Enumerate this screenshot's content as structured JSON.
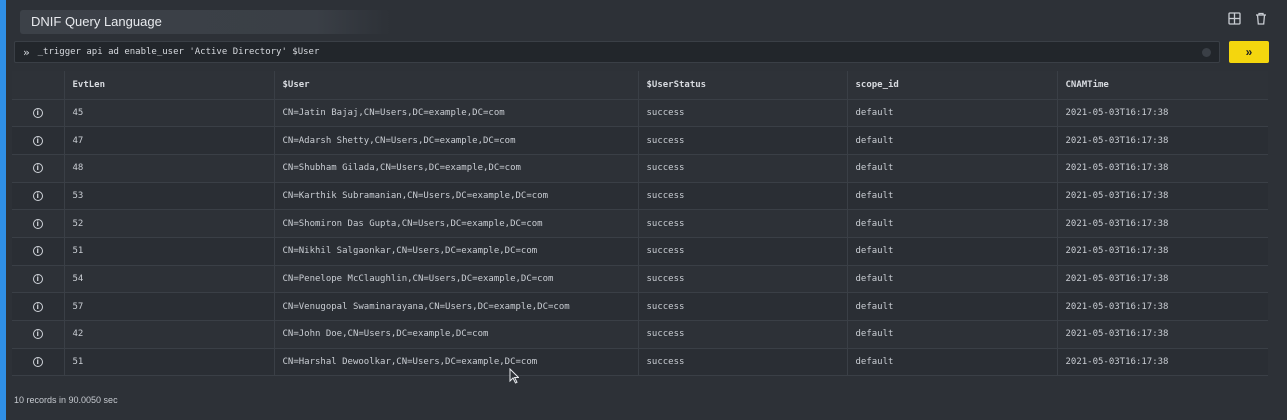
{
  "panel": {
    "title": "DNIF Query Language",
    "accent_color": "#2f8fe6",
    "icons": {
      "layout": "table-layout-icon",
      "delete": "trash-icon"
    }
  },
  "query": {
    "prompt_symbol": "»",
    "text": "_trigger api ad enable_user 'Active Directory' $User",
    "run_label": "»",
    "run_color": "#f4d60e"
  },
  "table": {
    "columns": [
      "",
      "EvtLen",
      "$User",
      "$UserStatus",
      "scope_id",
      "CNAMTime"
    ],
    "rows": [
      [
        "45",
        "CN=Jatin Bajaj,CN=Users,DC=example,DC=com",
        "success",
        "default",
        "2021-05-03T16:17:38"
      ],
      [
        "47",
        "CN=Adarsh Shetty,CN=Users,DC=example,DC=com",
        "success",
        "default",
        "2021-05-03T16:17:38"
      ],
      [
        "48",
        "CN=Shubham Gilada,CN=Users,DC=example,DC=com",
        "success",
        "default",
        "2021-05-03T16:17:38"
      ],
      [
        "53",
        "CN=Karthik Subramanian,CN=Users,DC=example,DC=com",
        "success",
        "default",
        "2021-05-03T16:17:38"
      ],
      [
        "52",
        "CN=Shomiron Das Gupta,CN=Users,DC=example,DC=com",
        "success",
        "default",
        "2021-05-03T16:17:38"
      ],
      [
        "51",
        "CN=Nikhil Salgaonkar,CN=Users,DC=example,DC=com",
        "success",
        "default",
        "2021-05-03T16:17:38"
      ],
      [
        "54",
        "CN=Penelope McClaughlin,CN=Users,DC=example,DC=com",
        "success",
        "default",
        "2021-05-03T16:17:38"
      ],
      [
        "57",
        "CN=Venugopal Swaminarayana,CN=Users,DC=example,DC=com",
        "success",
        "default",
        "2021-05-03T16:17:38"
      ],
      [
        "42",
        "CN=John Doe,CN=Users,DC=example,DC=com",
        "success",
        "default",
        "2021-05-03T16:17:38"
      ],
      [
        "51",
        "CN=Harshal Dewoolkar,CN=Users,DC=example,DC=com",
        "success",
        "default",
        "2021-05-03T16:17:38"
      ]
    ]
  },
  "footer": {
    "status": "10 records in 90.0050 sec"
  }
}
